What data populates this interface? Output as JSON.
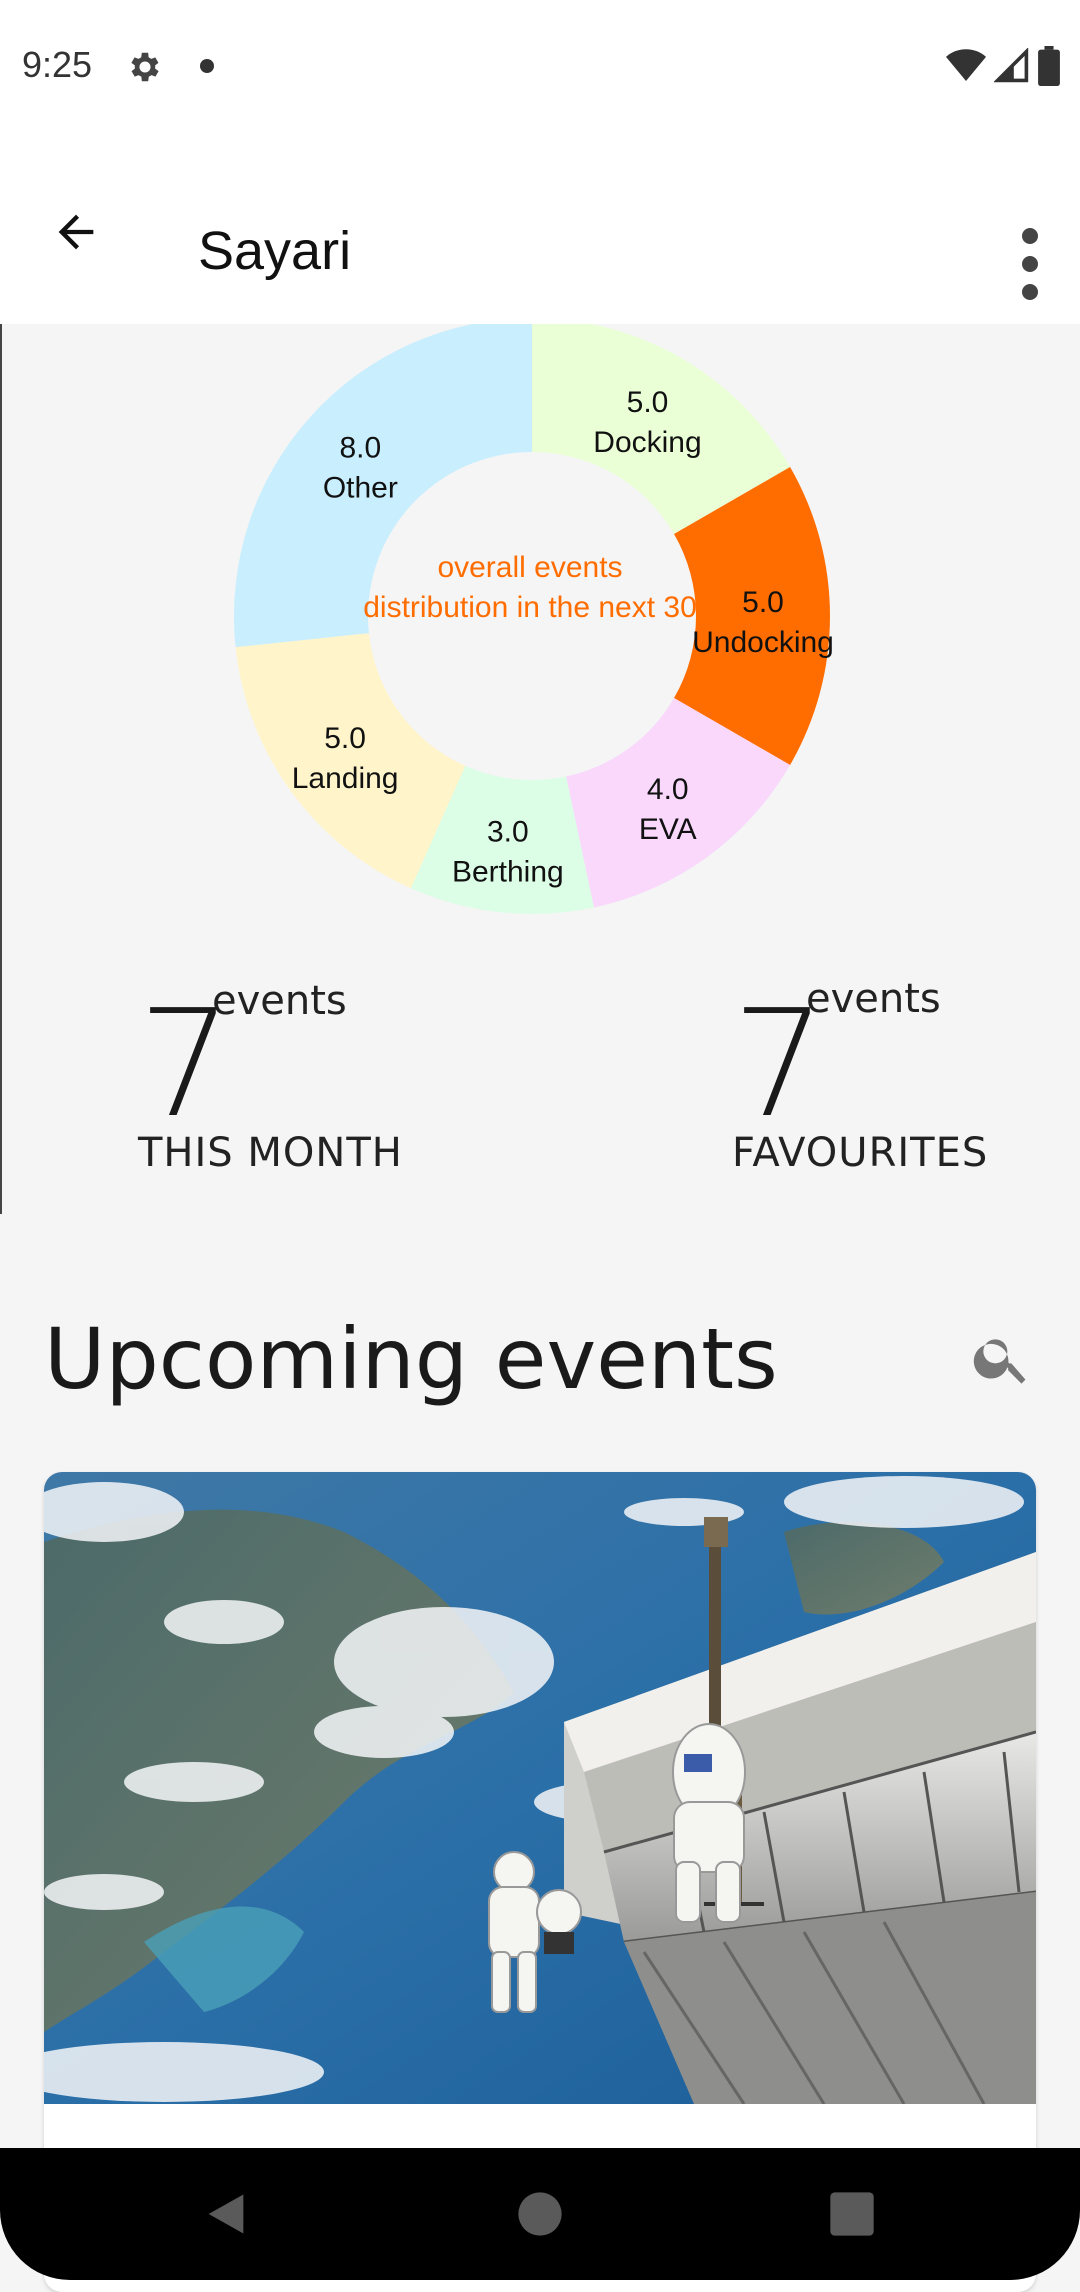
{
  "status_bar": {
    "time": "9:25",
    "icons": [
      "gear-icon",
      "dot-icon",
      "wifi-icon",
      "signal-icon",
      "battery-icon"
    ]
  },
  "app_bar": {
    "title": "Sayari",
    "back_icon": "arrow-back-icon",
    "menu_icon": "more-vert-icon"
  },
  "chart_data": {
    "type": "pie",
    "variant": "donut",
    "title": "overall events distribution in the next 30",
    "slices": [
      {
        "label": "Docking",
        "value": 5.0,
        "value_text": "5.0",
        "color": "#eaffd6"
      },
      {
        "label": "Undocking",
        "value": 5.0,
        "value_text": "5.0",
        "color": "#ff6d00"
      },
      {
        "label": "EVA",
        "value": 4.0,
        "value_text": "4.0",
        "color": "#f9d8fc"
      },
      {
        "label": "Berthing",
        "value": 3.0,
        "value_text": "3.0",
        "color": "#dcfde6"
      },
      {
        "label": "Landing",
        "value": 5.0,
        "value_text": "5.0",
        "color": "#fff4ca"
      },
      {
        "label": "Other",
        "value": 8.0,
        "value_text": "8.0",
        "color": "#c9eefe"
      }
    ]
  },
  "stats": {
    "month": {
      "number": "7",
      "unit": "events",
      "label": "THIS MONTH"
    },
    "favourites": {
      "number": "7",
      "unit": "events",
      "label": "FAVOURITES"
    }
  },
  "upcoming": {
    "title": "Upcoming events",
    "search_icon": "search-icon",
    "card_image": "spacewalk-photo"
  },
  "nav": {
    "icons": [
      "back-triangle-icon",
      "home-circle-icon",
      "recents-square-icon"
    ]
  }
}
